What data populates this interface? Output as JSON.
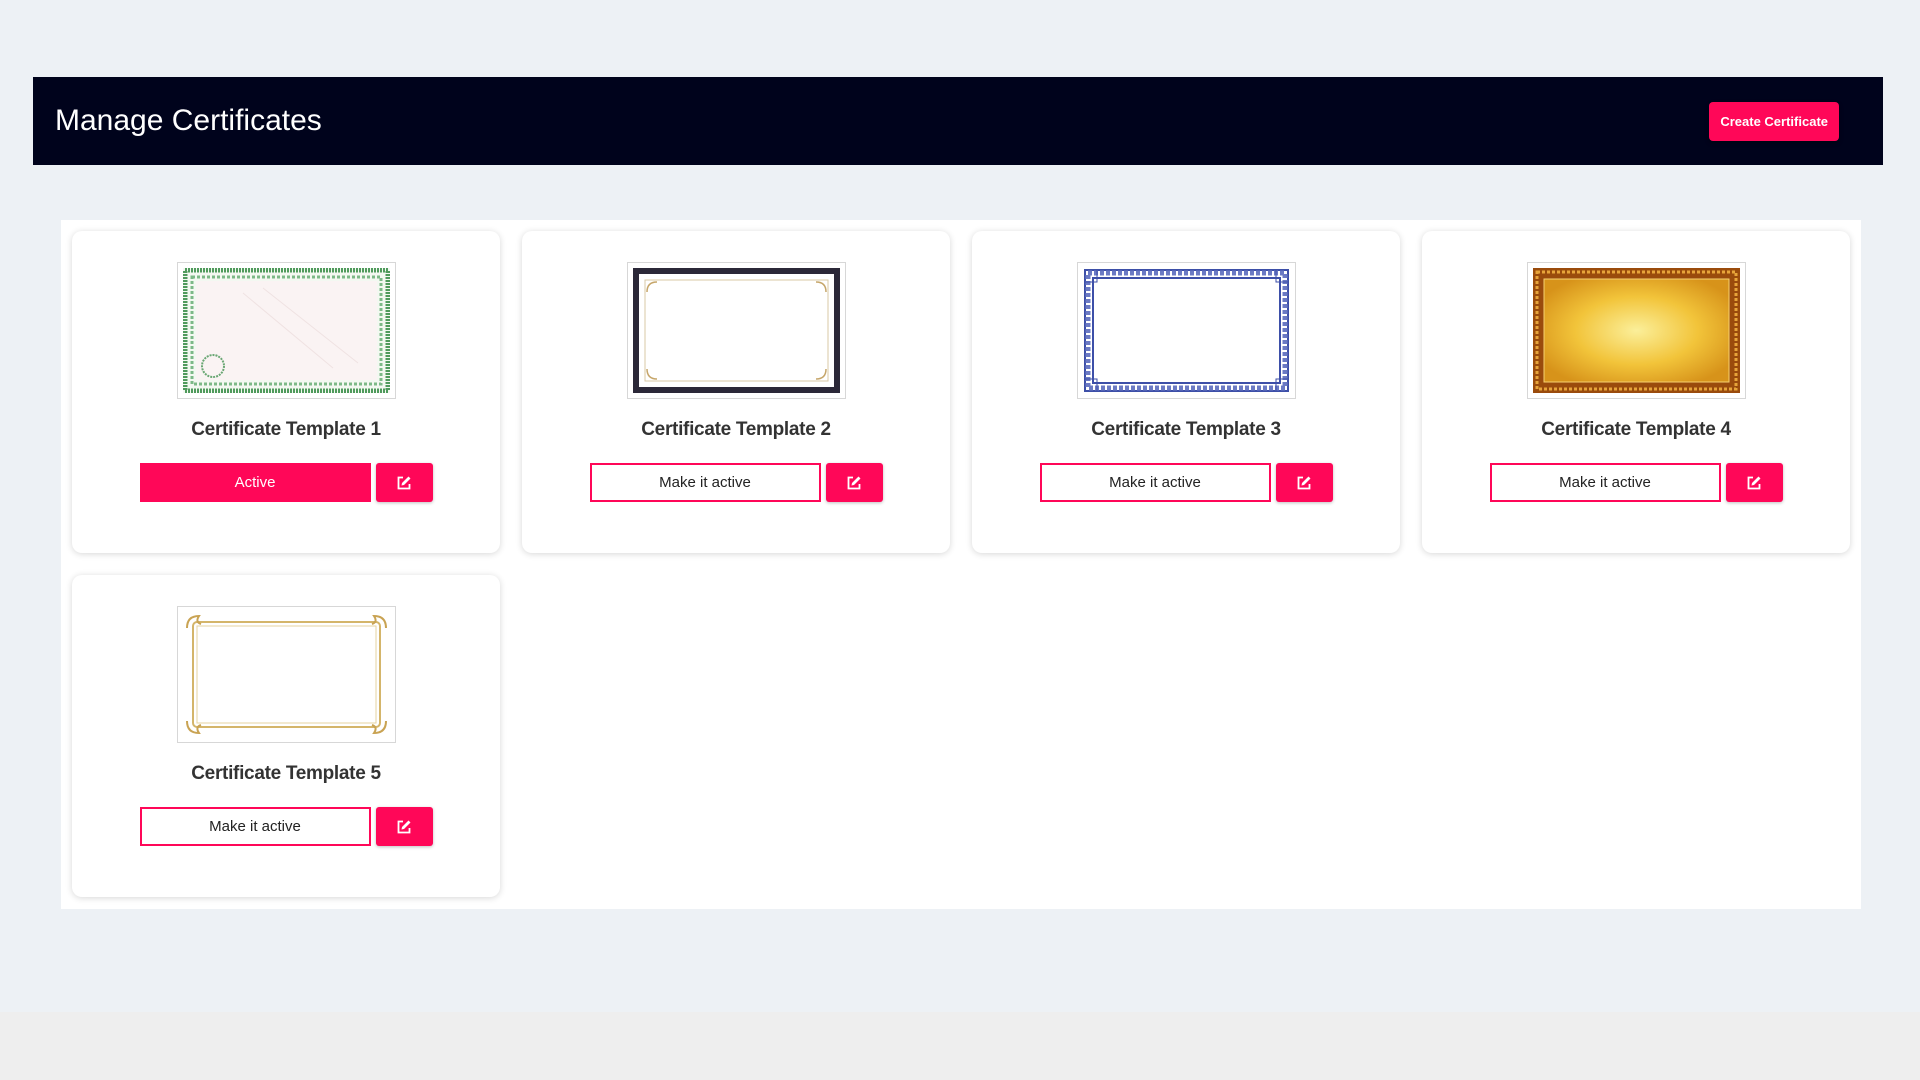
{
  "header": {
    "title": "Manage Certificates",
    "create_button_label": "Create Certificate"
  },
  "colors": {
    "accent": "#ff0758",
    "header_bg": "#00031c",
    "page_bg": "#edf1f5"
  },
  "templates": [
    {
      "title": "Certificate Template 1",
      "button_label": "Active",
      "is_active": true,
      "frame_style": "green-guilloche"
    },
    {
      "title": "Certificate Template 2",
      "button_label": "Make it active",
      "is_active": false,
      "frame_style": "dark-double-border"
    },
    {
      "title": "Certificate Template 3",
      "button_label": "Make it active",
      "is_active": false,
      "frame_style": "blue-chain-border"
    },
    {
      "title": "Certificate Template 4",
      "button_label": "Make it active",
      "is_active": false,
      "frame_style": "gold-ornate"
    },
    {
      "title": "Certificate Template 5",
      "button_label": "Make it active",
      "is_active": false,
      "frame_style": "gold-flourish"
    }
  ],
  "icons": {
    "edit": "edit-icon"
  }
}
